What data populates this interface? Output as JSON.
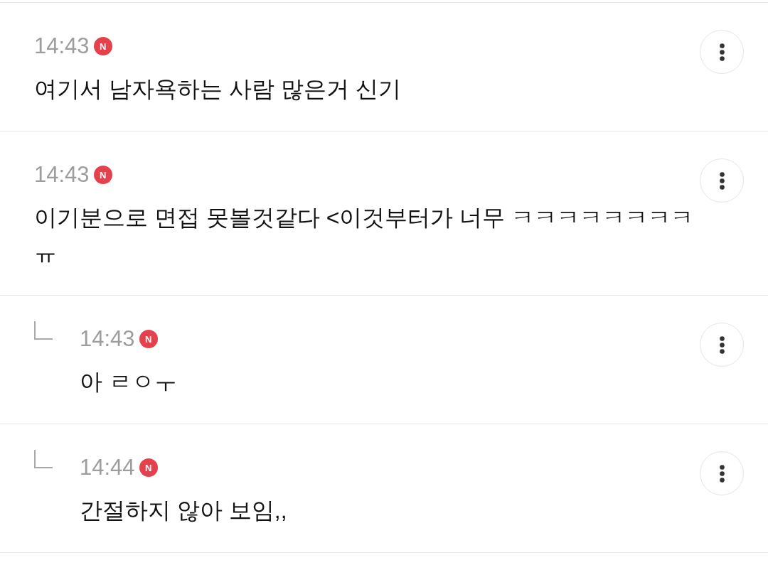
{
  "comments": [
    {
      "time": "14:43",
      "badge": "N",
      "text": "여기서 남자욕하는 사람 많은거 신기"
    },
    {
      "time": "14:43",
      "badge": "N",
      "text": "이기분으로 면접 못볼것같다 <이것부터가 너무 ㅋㅋㅋㅋㅋㅋㅋㅋㅠ",
      "children": [
        {
          "time": "14:43",
          "badge": "N",
          "text": "아 ㄹㅇㅜ"
        },
        {
          "time": "14:44",
          "badge": "N",
          "text": "간절하지 않아 보임,,"
        }
      ]
    }
  ]
}
